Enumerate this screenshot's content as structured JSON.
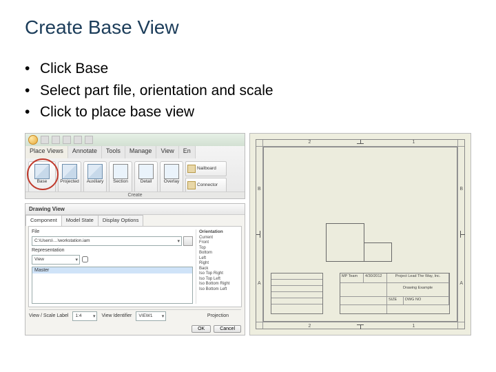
{
  "title": "Create Base View",
  "bullets": {
    "b1": "Click Base",
    "b2": "Select part file, orientation and scale",
    "b3": "Click to place base view"
  },
  "ribbon": {
    "tabs": {
      "t0": "Place Views",
      "t1": "Annotate",
      "t2": "Tools",
      "t3": "Manage",
      "t4": "View",
      "t5": "En"
    },
    "btns": {
      "base": "Base",
      "projected": "Projected",
      "auxiliary": "Auxiliary",
      "section": "Section",
      "detail": "Detail",
      "overlay": "Overlay"
    },
    "group": "Create",
    "side": {
      "nailboard": "Nailboard",
      "connector": "Connector"
    }
  },
  "dialog": {
    "title": "Drawing View",
    "tabs": {
      "component": "Component",
      "modelstate": "Model State",
      "display": "Display Options"
    },
    "file_label": "File",
    "file_value": "C:\\Users\\…\\workstation.iam",
    "rep_label": "Representation",
    "rep_value": "View",
    "list_item": "Master",
    "orient_header": "Orientation",
    "orient": {
      "o0": "Current",
      "o1": "Front",
      "o2": "Top",
      "o3": "Bottom",
      "o4": "Left",
      "o5": "Right",
      "o6": "Back",
      "o7": "Iso Top Right",
      "o8": "Iso Top Left",
      "o9": "Iso Bottom Right",
      "o10": "Iso Bottom Left"
    },
    "viewscale_label": "View / Scale Label",
    "scale_value": "1:4",
    "viewid_label": "View Identifier",
    "viewid_value": "VIEW1",
    "projection_label": "Projection",
    "ok": "OK",
    "cancel": "Cancel"
  },
  "sheet": {
    "zones": {
      "z2": "2",
      "z1": "1",
      "zB": "B",
      "zA": "A"
    },
    "titleblock": {
      "team": "MP Team",
      "date": "4/30/2012",
      "company": "Project Lead The Way, Inc.",
      "drawing": "Drawing Example",
      "size": "SIZE",
      "dwg": "DWG NO"
    }
  }
}
